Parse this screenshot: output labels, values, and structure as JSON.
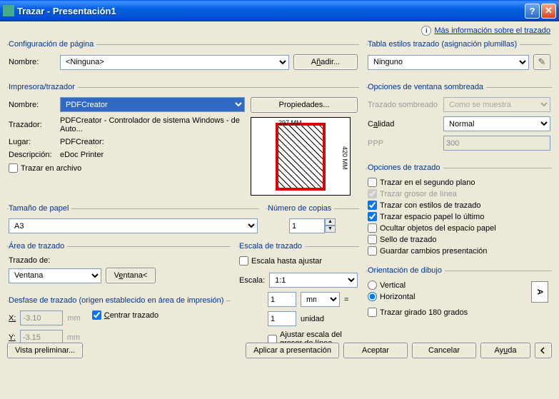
{
  "window": {
    "title": "Trazar - Presentación1"
  },
  "info_link": "Más información sobre el trazado",
  "page_setup": {
    "legend": "Configuración de página",
    "name_label": "Nombre:",
    "name_value": "<Ninguna>",
    "add_button": "Añadir..."
  },
  "printer": {
    "legend": "Impresora/trazador",
    "name_label": "Nombre:",
    "name_value": "PDFCreator",
    "props_button": "Propiedades...",
    "trazador_label": "Trazador:",
    "trazador_value": "PDFCreator - Controlador de sistema Windows - de Auto...",
    "lugar_label": "Lugar:",
    "lugar_value": "PDFCreator:",
    "desc_label": "Descripción:",
    "desc_value": "eDoc Printer",
    "trazar_archivo": "Trazar en archivo",
    "preview_w": "297 MM",
    "preview_h": "420 MM"
  },
  "paper": {
    "legend": "Tamaño de papel",
    "value": "A3"
  },
  "copies": {
    "legend": "Número de copias",
    "value": "1"
  },
  "area": {
    "legend": "Área de trazado",
    "sub_label": "Trazado de:",
    "value": "Ventana",
    "window_button": "Ventana<"
  },
  "offset": {
    "legend": "Desfase de trazado (origen establecido en área de impresión)",
    "x_label": "X:",
    "x_value": "-3.10",
    "y_label": "Y:",
    "y_value": "-3.15",
    "unit": "mm",
    "center": "Centrar trazado"
  },
  "scale": {
    "legend": "Escala de trazado",
    "fit": "Escala hasta ajustar",
    "scale_label": "Escala:",
    "scale_value": "1:1",
    "num1": "1",
    "unit1": "mm",
    "num2": "1",
    "unit2": "unidad",
    "adjust_lw": "Ajustar escala del grosor de línea",
    "eq": "="
  },
  "styles": {
    "legend": "Tabla estilos trazado (asignación plumillas)",
    "value": "Ninguno"
  },
  "shaded": {
    "legend": "Opciones de ventana sombreada",
    "shade_label": "Trazado sombreado",
    "shade_value": "Como se muestra",
    "quality_label": "Calidad",
    "quality_value": "Normal",
    "ppp_label": "PPP",
    "ppp_value": "300"
  },
  "plot_opts": {
    "legend": "Opciones de trazado",
    "bg": "Trazar en el segundo plano",
    "lw": "Trazar grosor de línea",
    "styles": "Trazar con estilos de trazado",
    "space": "Trazar espacio papel lo último",
    "hide": "Ocultar objetos del espacio papel",
    "stamp": "Sello de trazado",
    "save": "Guardar cambios presentación"
  },
  "orient": {
    "legend": "Orientación de dibujo",
    "vertical": "Vertical",
    "horizontal": "Horizontal",
    "rotate": "Trazar girado 180 grados"
  },
  "footer": {
    "preview": "Vista preliminar...",
    "apply": "Aplicar a presentación",
    "ok": "Aceptar",
    "cancel": "Cancelar",
    "help": "Ayuda"
  }
}
